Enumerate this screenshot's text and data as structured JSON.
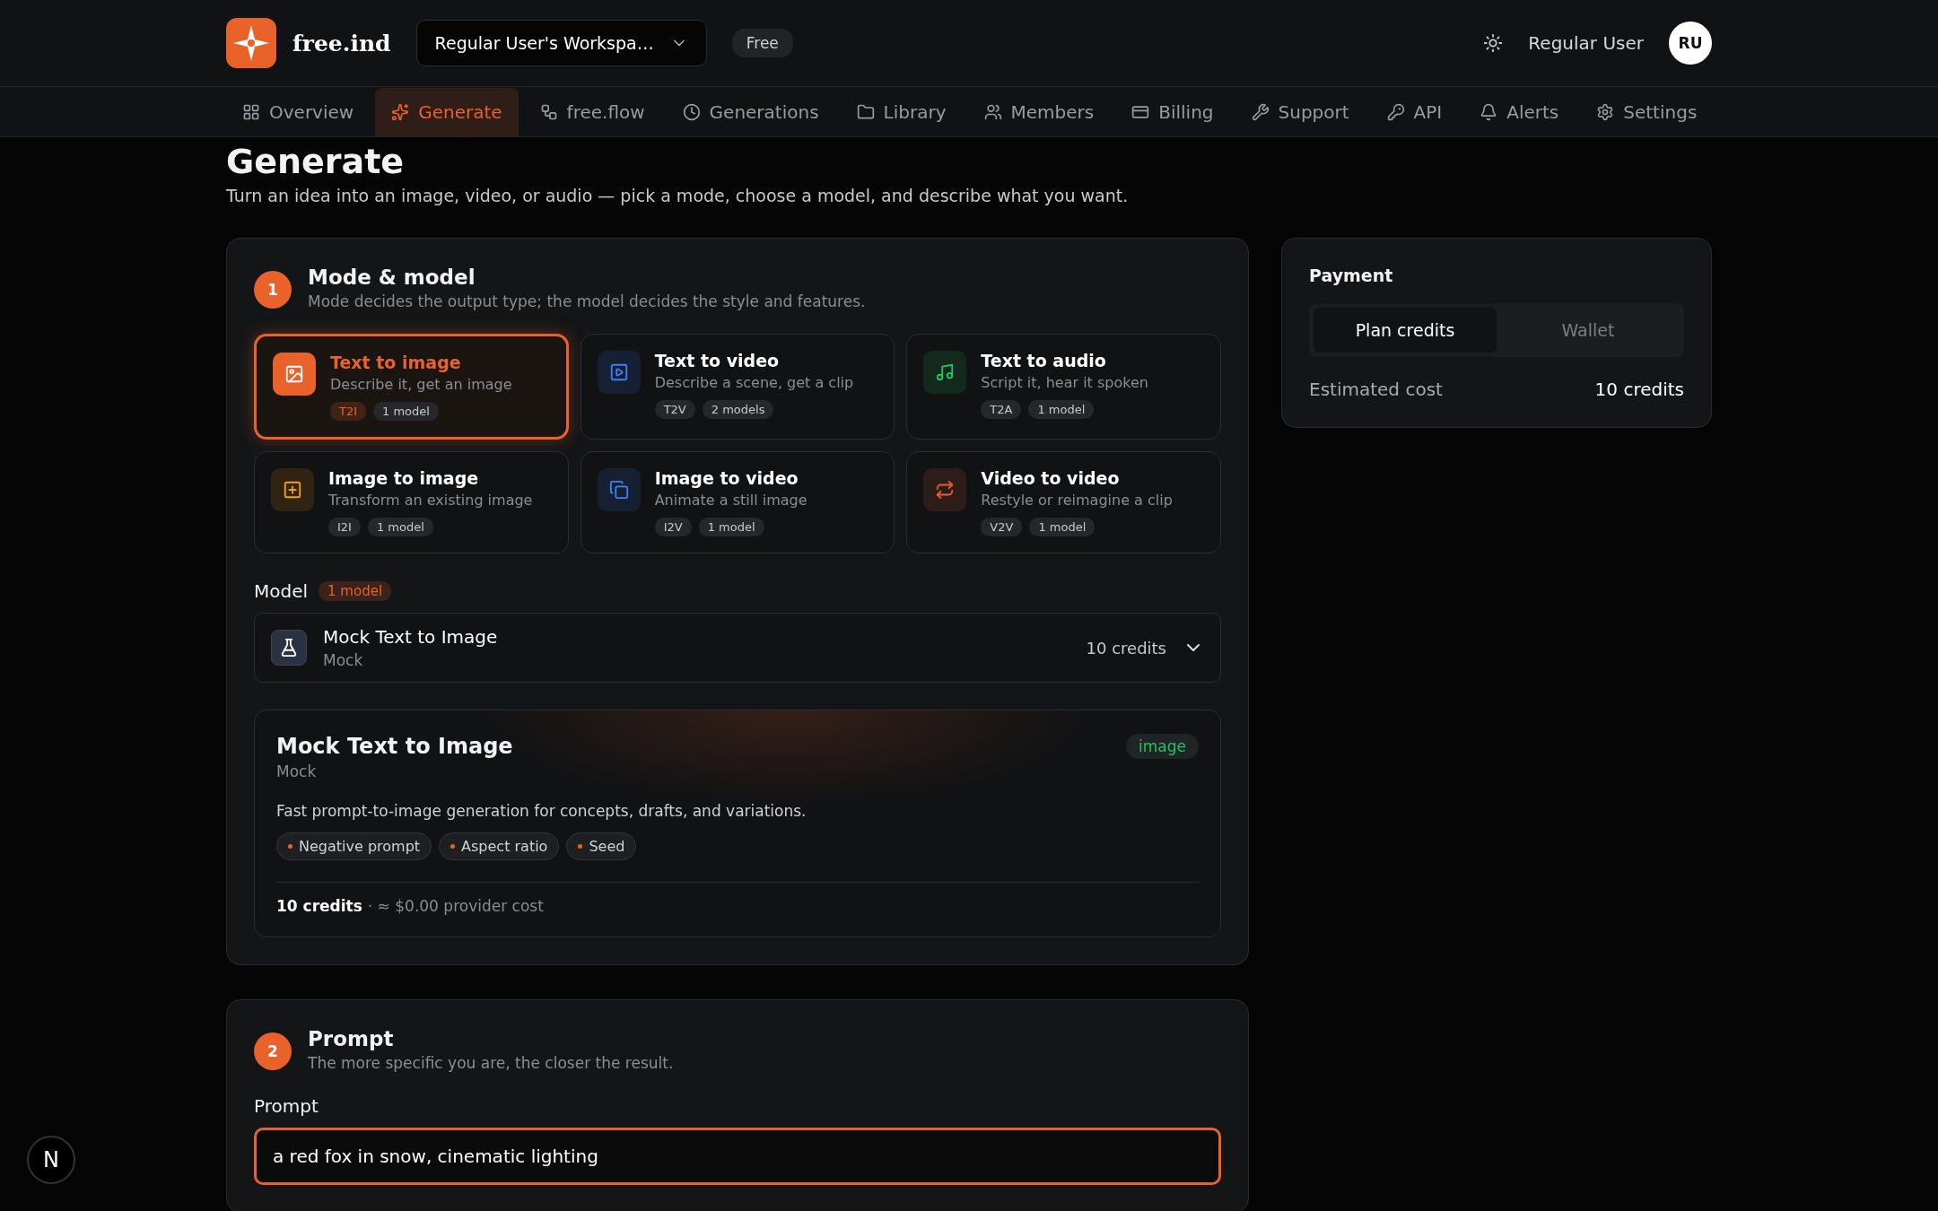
{
  "header": {
    "brand": "free.ind",
    "workspace": "Regular User's Workspa…",
    "plan": "Free",
    "user_name": "Regular User",
    "avatar_initials": "RU"
  },
  "nav": [
    {
      "label": "Overview",
      "kind": "grid",
      "selected": false
    },
    {
      "label": "Generate",
      "kind": "sparkles",
      "selected": true
    },
    {
      "label": "free.flow",
      "kind": "flow",
      "selected": false
    },
    {
      "label": "Generations",
      "kind": "clock",
      "selected": false
    },
    {
      "label": "Library",
      "kind": "folder",
      "selected": false
    },
    {
      "label": "Members",
      "kind": "users",
      "selected": false
    },
    {
      "label": "Billing",
      "kind": "card",
      "selected": false
    },
    {
      "label": "Support",
      "kind": "tools",
      "selected": false
    },
    {
      "label": "API",
      "kind": "key",
      "selected": false
    },
    {
      "label": "Alerts",
      "kind": "bell",
      "selected": false
    },
    {
      "label": "Settings",
      "kind": "gear",
      "selected": false
    }
  ],
  "page": {
    "title": "Generate",
    "subtitle": "Turn an idea into an image, video, or audio — pick a mode, choose a model, and describe what you want."
  },
  "mode_section": {
    "step": "1",
    "title": "Mode & model",
    "subtitle": "Mode decides the output type; the model decides the style and features.",
    "modes": [
      {
        "title": "Text to image",
        "description": "Describe it, get an image",
        "code": "T2I",
        "models": "1 model",
        "kind": "image",
        "color": "#e8622a",
        "selected": true
      },
      {
        "title": "Text to video",
        "description": "Describe a scene, get a clip",
        "code": "T2V",
        "models": "2 models",
        "kind": "play",
        "color": "#3b82f6",
        "selected": false
      },
      {
        "title": "Text to audio",
        "description": "Script it, hear it spoken",
        "code": "T2A",
        "models": "1 model",
        "kind": "music",
        "color": "#22c55e",
        "selected": false
      },
      {
        "title": "Image to image",
        "description": "Transform an existing image",
        "code": "I2I",
        "models": "1 model",
        "kind": "plus",
        "color": "#f59e0b",
        "selected": false
      },
      {
        "title": "Image to video",
        "description": "Animate a still image",
        "code": "I2V",
        "models": "1 model",
        "kind": "layers",
        "color": "#3b82f6",
        "selected": false
      },
      {
        "title": "Video to video",
        "description": "Restyle or reimagine a clip",
        "code": "V2V",
        "models": "1 model",
        "kind": "repeat",
        "color": "#e8622a",
        "selected": false
      }
    ],
    "model_label": "Model",
    "model_count": "1 model",
    "model_select": {
      "name": "Mock Text to Image",
      "provider": "Mock",
      "cost": "10 credits"
    },
    "model_card": {
      "name": "Mock Text to Image",
      "provider": "Mock",
      "output_type": "image",
      "description": "Fast prompt-to-image generation for concepts, drafts, and variations.",
      "features": [
        "Negative prompt",
        "Aspect ratio",
        "Seed"
      ],
      "cost": "10 credits",
      "provider_cost": "· ≈ $0.00 provider cost"
    }
  },
  "payment": {
    "title": "Payment",
    "options": [
      {
        "label": "Plan credits",
        "selected": true
      },
      {
        "label": "Wallet",
        "selected": false
      }
    ],
    "estimate_label": "Estimated cost",
    "estimate_value": "10 credits"
  },
  "prompt_section": {
    "step": "2",
    "title": "Prompt",
    "subtitle": "The more specific you are, the closer the result.",
    "field_label": "Prompt",
    "value": "a red fox in snow, cinematic lighting"
  },
  "dev_badge": "N"
}
